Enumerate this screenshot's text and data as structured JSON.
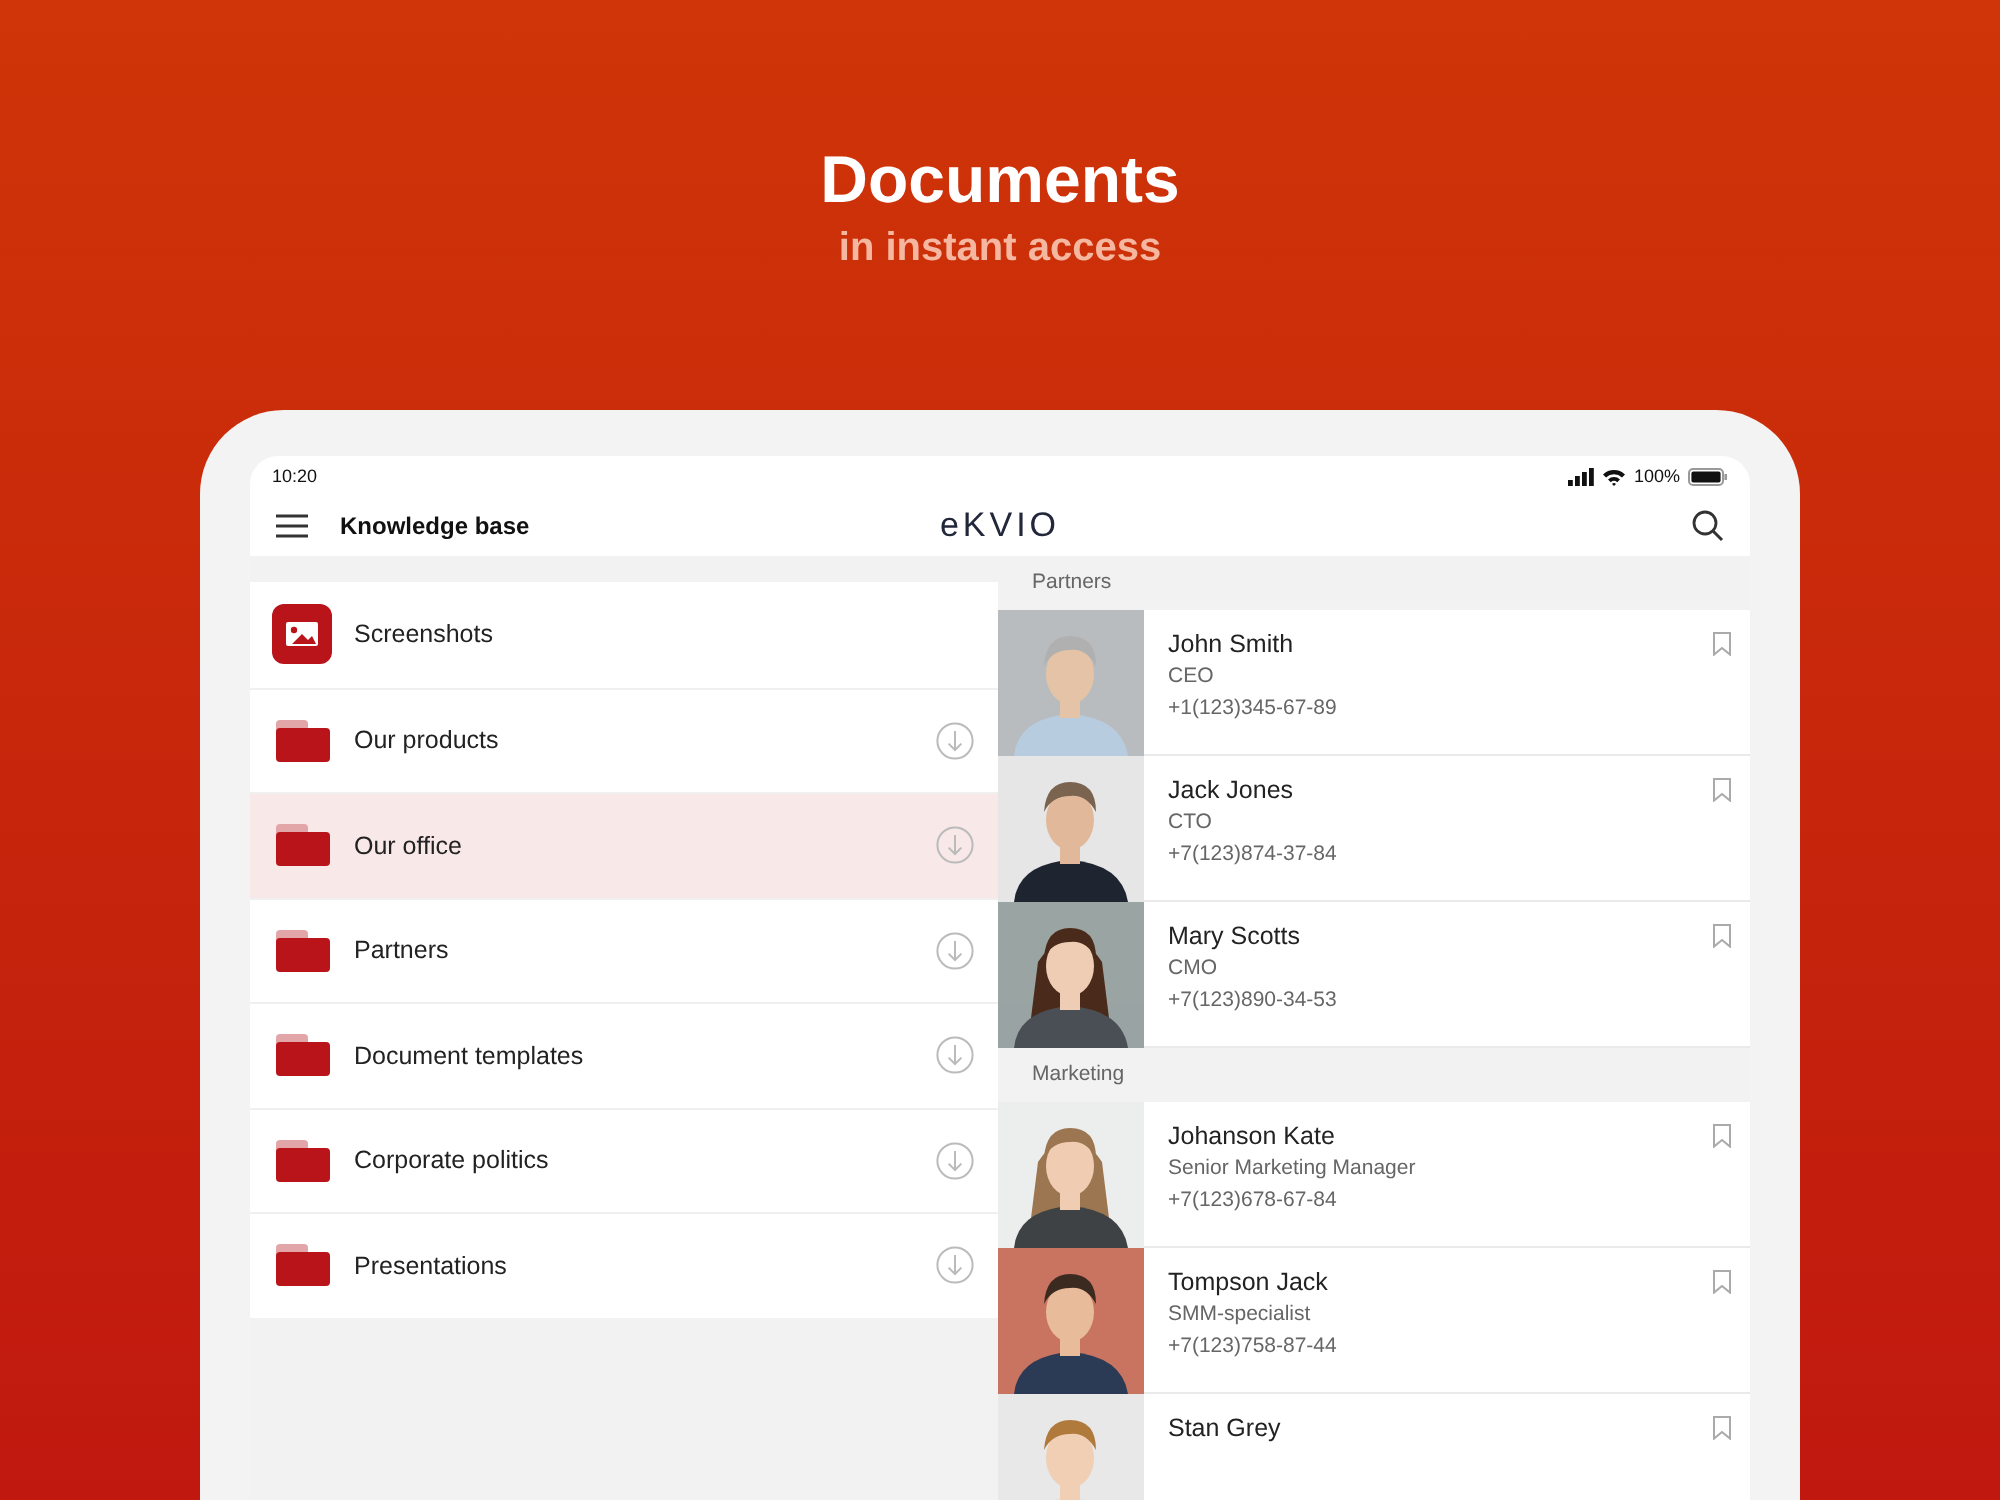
{
  "headline": {
    "title": "Documents",
    "subtitle": "in instant access"
  },
  "status_bar": {
    "time": "10:20",
    "battery": "100%"
  },
  "nav_bar": {
    "title": "Knowledge base",
    "logo": "eKVIO"
  },
  "folders": [
    {
      "label": "Screenshots",
      "kind": "gallery",
      "selected": false
    },
    {
      "label": "Our products",
      "kind": "folder",
      "selected": false
    },
    {
      "label": "Our office",
      "kind": "folder",
      "selected": true
    },
    {
      "label": "Partners",
      "kind": "folder",
      "selected": false
    },
    {
      "label": "Document templates",
      "kind": "folder",
      "selected": false
    },
    {
      "label": "Corporate politics",
      "kind": "folder",
      "selected": false
    },
    {
      "label": "Presentations",
      "kind": "folder",
      "selected": false
    }
  ],
  "contact_groups": [
    {
      "title": "Partners",
      "contacts": [
        {
          "name": "John Smith",
          "position": "CEO",
          "phone": "+1(123)345-67-89"
        },
        {
          "name": "Jack Jones",
          "position": "CTO",
          "phone": "+7(123)874-37-84"
        },
        {
          "name": "Mary Scotts",
          "position": "CMO",
          "phone": "+7(123)890-34-53"
        }
      ]
    },
    {
      "title": "Marketing",
      "contacts": [
        {
          "name": "Johanson Kate",
          "position": "Senior Marketing Manager",
          "phone": "+7(123)678-67-84"
        },
        {
          "name": "Tompson Jack",
          "position": "SMM-specialist",
          "phone": "+7(123)758-87-44"
        },
        {
          "name": "Stan Grey"
        }
      ]
    }
  ]
}
